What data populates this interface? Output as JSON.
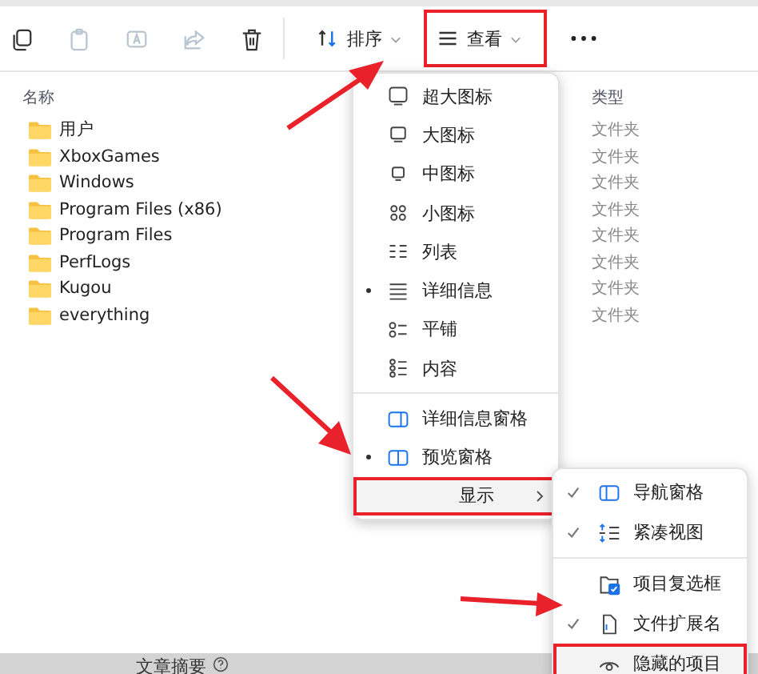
{
  "toolbar": {
    "icons": [
      {
        "kind": "copy",
        "disabled": false
      },
      {
        "kind": "paste",
        "disabled": true
      },
      {
        "kind": "rename",
        "disabled": true
      },
      {
        "kind": "share",
        "disabled": true
      },
      {
        "kind": "delete",
        "disabled": false
      }
    ],
    "sort_button": {
      "label": "排序"
    },
    "view_button": {
      "label": "查看",
      "highlighted": true
    }
  },
  "columns": [
    "名称",
    "类型"
  ],
  "rows": [
    {
      "name": "用户",
      "type": "文件夹"
    },
    {
      "name": "XboxGames",
      "type": "文件夹"
    },
    {
      "name": "Windows",
      "type": "文件夹"
    },
    {
      "name": "Program Files (x86)",
      "type": "文件夹"
    },
    {
      "name": "Program Files",
      "type": "文件夹"
    },
    {
      "name": "PerfLogs",
      "type": "文件夹"
    },
    {
      "name": "Kugou",
      "type": "文件夹"
    },
    {
      "name": "everything",
      "type": "文件夹"
    }
  ],
  "view_menu": {
    "layouts": [
      {
        "kind": "xl",
        "label": "超大图标",
        "selected": false
      },
      {
        "kind": "lg",
        "label": "大图标",
        "selected": false
      },
      {
        "kind": "md",
        "label": "中图标",
        "selected": false
      },
      {
        "kind": "sm",
        "label": "小图标",
        "selected": false
      },
      {
        "kind": "list",
        "label": "列表",
        "selected": false
      },
      {
        "kind": "details",
        "label": "详细信息",
        "selected": true
      },
      {
        "kind": "tiles",
        "label": "平铺",
        "selected": false
      },
      {
        "kind": "content",
        "label": "内容",
        "selected": false
      }
    ],
    "panes": [
      {
        "kind": "details-pane",
        "label": "详细信息窗格",
        "selected": false
      },
      {
        "kind": "preview-pane",
        "label": "预览窗格",
        "selected": true
      }
    ],
    "show": {
      "label": "显示",
      "highlighted": true
    }
  },
  "show_menu": {
    "groups": [
      [
        {
          "kind": "nav",
          "label": "导航窗格",
          "checked": true,
          "highlighted": false
        },
        {
          "kind": "compact",
          "label": "紧凑视图",
          "checked": true,
          "highlighted": false
        }
      ],
      [
        {
          "kind": "checkbox",
          "label": "项目复选框",
          "checked": false,
          "highlighted": false
        },
        {
          "kind": "ext",
          "label": "文件扩展名",
          "checked": true,
          "highlighted": false
        },
        {
          "kind": "hidden",
          "label": "隐藏的项目",
          "checked": false,
          "highlighted": true
        }
      ]
    ]
  },
  "bottom_bar": {
    "label": "文章摘要"
  }
}
